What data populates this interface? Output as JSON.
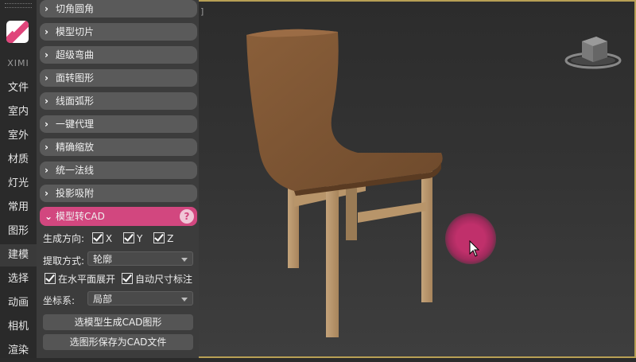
{
  "app": {
    "brand": "XIMI",
    "viewport_label": "]"
  },
  "nav": {
    "items": [
      {
        "label": "文件",
        "active": false
      },
      {
        "label": "室内",
        "active": false
      },
      {
        "label": "室外",
        "active": false
      },
      {
        "label": "材质",
        "active": false
      },
      {
        "label": "灯光",
        "active": false
      },
      {
        "label": "常用",
        "active": false
      },
      {
        "label": "图形",
        "active": false
      },
      {
        "label": "建模",
        "active": true
      },
      {
        "label": "选择",
        "active": false
      },
      {
        "label": "动画",
        "active": false
      },
      {
        "label": "相机",
        "active": false
      },
      {
        "label": "渲染",
        "active": false
      }
    ]
  },
  "panel": {
    "sections": [
      "切角圆角",
      "模型切片",
      "超级弯曲",
      "面转图形",
      "线面弧形",
      "一键代理",
      "精确缩放",
      "统一法线",
      "投影吸附"
    ],
    "open_section": {
      "title": "模型转CAD",
      "help": "?",
      "direction_label": "生成方向:",
      "axes": [
        "X",
        "Y",
        "Z"
      ],
      "extract_label": "提取方式:",
      "extract_value": "轮廓",
      "expand_label": "在水平面展开",
      "auto_dim_label": "自动尺寸标注",
      "coord_label": "坐标系:",
      "coord_value": "局部",
      "btn_generate": "选模型生成CAD图形",
      "btn_save": "选图形保存为CAD文件"
    }
  },
  "colors": {
    "accent": "#d2477f",
    "viewport_border": "#b8a055"
  }
}
